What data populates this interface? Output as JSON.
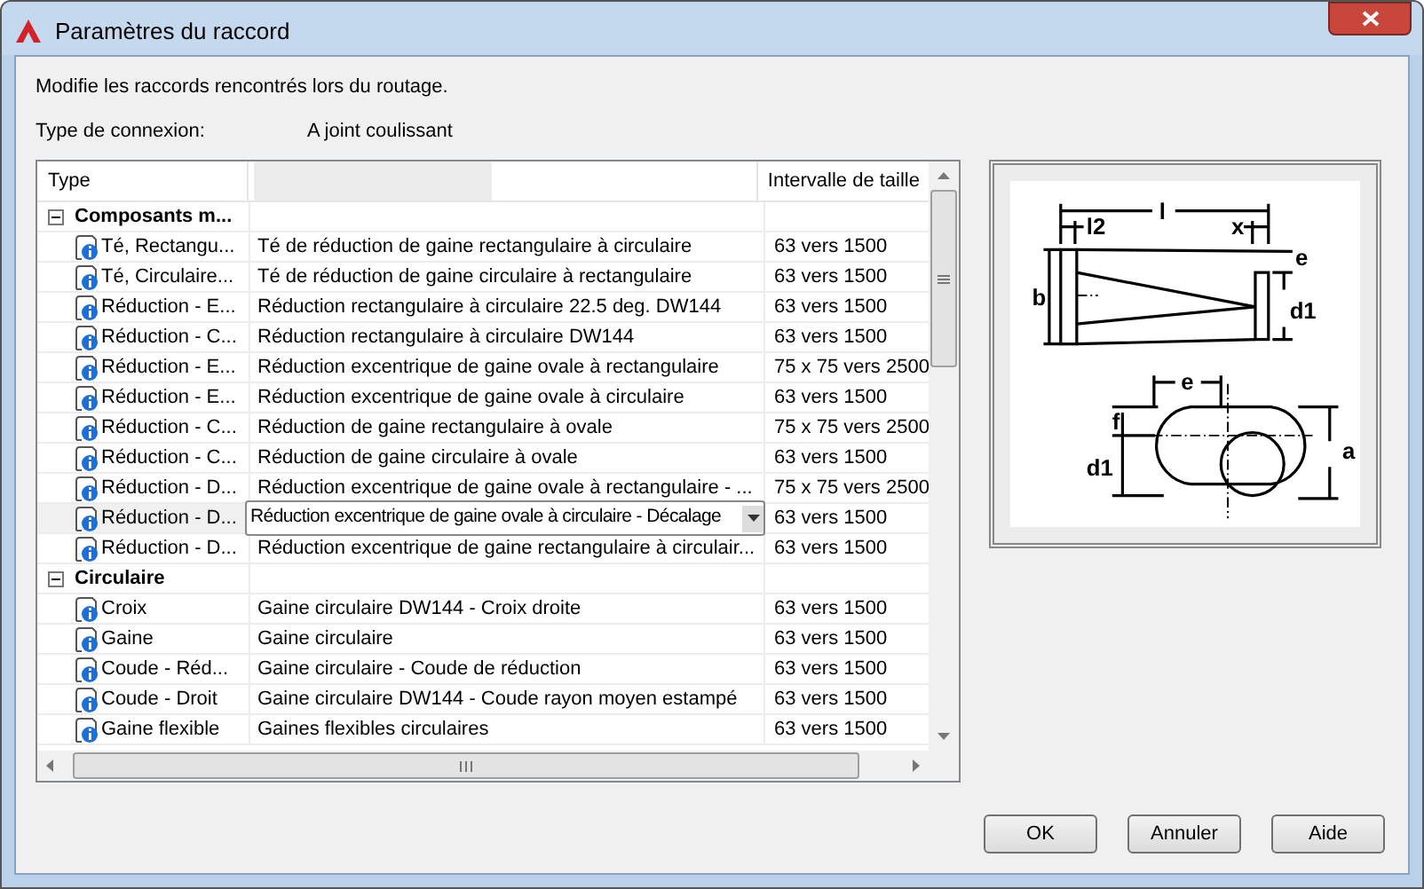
{
  "window": {
    "title": "Paramètres du raccord"
  },
  "description": "Modifie les raccords rencontrés lors du routage.",
  "connection": {
    "label": "Type de connexion:",
    "value": "A joint coulissant"
  },
  "table": {
    "columns": [
      "Type",
      "Intervalle de taille"
    ],
    "groups": [
      {
        "label": "Composants m...",
        "expanded": true,
        "children": [
          {
            "type": "Té, Rectangu...",
            "description": "Té de réduction de gaine rectangulaire à circulaire",
            "range": "63 vers 1500",
            "editing": false
          },
          {
            "type": "Té, Circulaire...",
            "description": "Té de réduction de gaine circulaire à rectangulaire",
            "range": "63 vers 1500",
            "editing": false
          },
          {
            "type": "Réduction - E...",
            "description": "Réduction rectangulaire à circulaire 22.5 deg. DW144",
            "range": "63 vers 1500",
            "editing": false
          },
          {
            "type": "Réduction - C...",
            "description": "Réduction rectangulaire à circulaire DW144",
            "range": "63 vers 1500",
            "editing": false
          },
          {
            "type": "Réduction - E...",
            "description": "Réduction excentrique de gaine ovale à rectangulaire",
            "range": "75 x 75 vers 2500",
            "editing": false
          },
          {
            "type": "Réduction - E...",
            "description": "Réduction excentrique de gaine ovale à circulaire",
            "range": "63 vers 1500",
            "editing": false
          },
          {
            "type": "Réduction - C...",
            "description": "Réduction de gaine rectangulaire à ovale",
            "range": "75 x 75 vers 2500",
            "editing": false
          },
          {
            "type": "Réduction - C...",
            "description": "Réduction de gaine circulaire à ovale",
            "range": "63 vers 1500",
            "editing": false
          },
          {
            "type": "Réduction - D...",
            "description": "Réduction excentrique de gaine ovale à rectangulaire - ...",
            "range": "75 x 75 vers 2500",
            "editing": false
          },
          {
            "type": "Réduction - D...",
            "description": "Réduction excentrique de gaine ovale à circulaire - Décalage",
            "range": "63 vers 1500",
            "editing": true
          },
          {
            "type": "Réduction - D...",
            "description": "Réduction excentrique de gaine rectangulaire à circulair...",
            "range": "63 vers 1500",
            "editing": false
          }
        ]
      },
      {
        "label": "Circulaire",
        "expanded": true,
        "children": [
          {
            "type": "Croix",
            "description": "Gaine circulaire DW144 - Croix droite",
            "range": "63 vers 1500",
            "editing": false
          },
          {
            "type": "Gaine",
            "description": "Gaine circulaire",
            "range": "63 vers 1500",
            "editing": false
          },
          {
            "type": "Coude - Réd...",
            "description": "Gaine circulaire - Coude de réduction",
            "range": "63 vers 1500",
            "editing": false
          },
          {
            "type": "Coude - Droit",
            "description": "Gaine circulaire DW144 - Coude rayon moyen estampé",
            "range": "63 vers 1500",
            "editing": false
          },
          {
            "type": "Gaine flexible",
            "description": "Gaines flexibles circulaires",
            "range": "63 vers 1500",
            "editing": false
          }
        ]
      }
    ]
  },
  "diagram": {
    "labels": [
      "l",
      "l2",
      "x",
      "b",
      "e",
      "d1",
      "e",
      "f",
      "d1",
      "a"
    ]
  },
  "buttons": [
    "OK",
    "Annuler",
    "Aide"
  ]
}
